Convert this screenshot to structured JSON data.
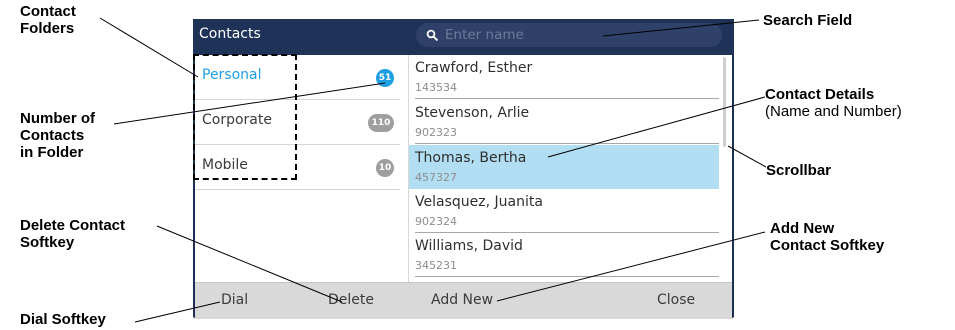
{
  "window": {
    "title": "Contacts",
    "search": {
      "placeholder": "Enter name"
    }
  },
  "folders": [
    {
      "name": "Personal",
      "count": "51",
      "active": true
    },
    {
      "name": "Corporate",
      "count": "110",
      "active": false
    },
    {
      "name": "Mobile",
      "count": "10",
      "active": false
    }
  ],
  "contacts": [
    {
      "name": "Crawford, Esther",
      "number": "143534",
      "selected": false
    },
    {
      "name": "Stevenson, Arlie",
      "number": "902323",
      "selected": false
    },
    {
      "name": "Thomas, Bertha",
      "number": "457327",
      "selected": true
    },
    {
      "name": "Velasquez, Juanita",
      "number": "902324",
      "selected": false
    },
    {
      "name": "Williams, David",
      "number": "345231",
      "selected": false
    }
  ],
  "softkeys": {
    "dial": "Dial",
    "delete": "Delete",
    "add_new": "Add New",
    "close": "Close"
  },
  "callouts": {
    "contact_folders": [
      "Contact",
      "Folders"
    ],
    "number_of_contacts": [
      "Number of",
      "Contacts",
      "in Folder"
    ],
    "delete_softkey": [
      "Delete Contact",
      "Softkey"
    ],
    "dial_softkey": "Dial Softkey",
    "search_field": "Search Field",
    "contact_details": "Contact Details",
    "contact_details_sub": "(Name and Number)",
    "scrollbar": "Scrollbar",
    "add_new_softkey": [
      "Add New",
      "Contact Softkey"
    ]
  },
  "colors": {
    "title_bar": "#1f3358",
    "accent_blue": "#1e9fe3",
    "selected_row": "#b1def2",
    "softkey_bar": "#d9d9d9",
    "badge_gray": "#9e9e9e"
  },
  "icons": {
    "search": "search-icon"
  }
}
